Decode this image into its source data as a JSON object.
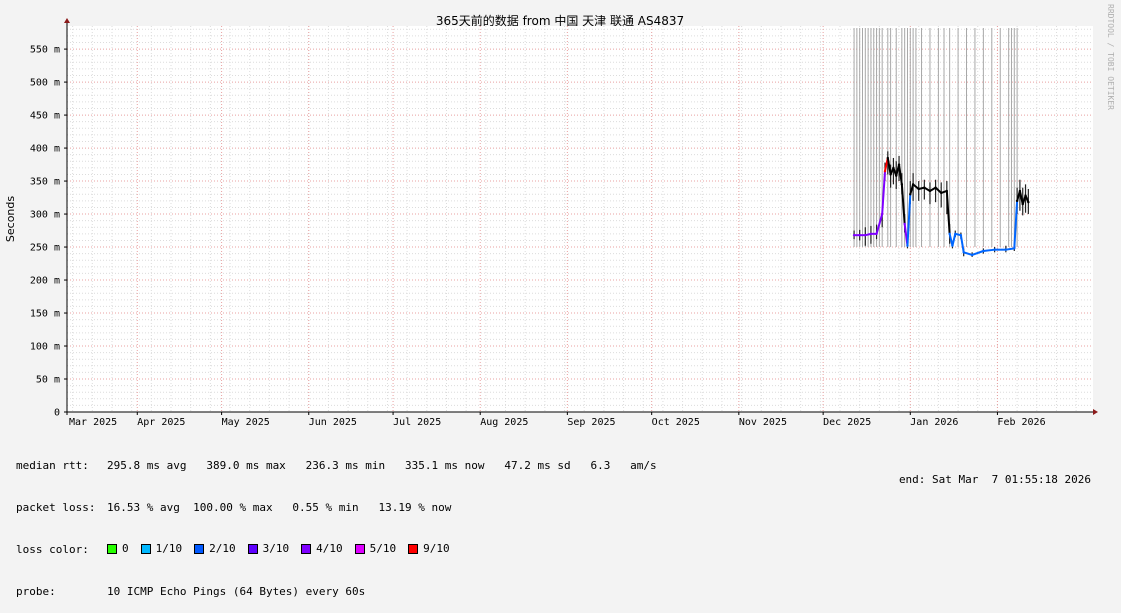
{
  "chart_data": {
    "type": "line",
    "title": "365天前的数据 from 中国 天津 联通 AS4837",
    "ylabel": "Seconds",
    "ylim": [
      0,
      0.585
    ],
    "y_ticks": [
      {
        "value": 0,
        "label": "0"
      },
      {
        "value": 0.05,
        "label": "50 m"
      },
      {
        "value": 0.1,
        "label": "100 m"
      },
      {
        "value": 0.15,
        "label": "150 m"
      },
      {
        "value": 0.2,
        "label": "200 m"
      },
      {
        "value": 0.25,
        "label": "250 m"
      },
      {
        "value": 0.3,
        "label": "300 m"
      },
      {
        "value": 0.35,
        "label": "350 m"
      },
      {
        "value": 0.4,
        "label": "400 m"
      },
      {
        "value": 0.45,
        "label": "450 m"
      },
      {
        "value": 0.5,
        "label": "500 m"
      },
      {
        "value": 0.55,
        "label": "550 m"
      }
    ],
    "xlim": [
      "2025-03-07",
      "2026-03-07"
    ],
    "x_ticks": [
      {
        "date": "2025-03-01",
        "label": "Mar 2025"
      },
      {
        "date": "2025-04-01",
        "label": "Apr 2025"
      },
      {
        "date": "2025-05-01",
        "label": "May 2025"
      },
      {
        "date": "2025-06-01",
        "label": "Jun 2025"
      },
      {
        "date": "2025-07-01",
        "label": "Jul 2025"
      },
      {
        "date": "2025-08-01",
        "label": "Aug 2025"
      },
      {
        "date": "2025-09-01",
        "label": "Sep 2025"
      },
      {
        "date": "2025-10-01",
        "label": "Oct 2025"
      },
      {
        "date": "2025-11-01",
        "label": "Nov 2025"
      },
      {
        "date": "2025-12-01",
        "label": "Dec 2025"
      },
      {
        "date": "2026-01-01",
        "label": "Jan 2026"
      },
      {
        "date": "2026-02-01",
        "label": "Feb 2026"
      }
    ],
    "grid": true,
    "series": [
      {
        "points": [
          {
            "date": "2025-12-12",
            "median": 0.268,
            "min": 0.262,
            "max": 0.275,
            "color": "#7e00ff"
          },
          {
            "date": "2025-12-14",
            "median": 0.268,
            "min": 0.26,
            "max": 0.276,
            "color": "#7e00ff"
          },
          {
            "date": "2025-12-16",
            "median": 0.268,
            "min": 0.252,
            "max": 0.28,
            "color": "#7e00ff"
          },
          {
            "date": "2025-12-18",
            "median": 0.27,
            "min": 0.255,
            "max": 0.282,
            "color": "#7e00ff"
          },
          {
            "date": "2025-12-20",
            "median": 0.27,
            "min": 0.262,
            "max": 0.284,
            "color": "#7e00ff"
          },
          {
            "date": "2025-12-22",
            "median": 0.3,
            "min": 0.28,
            "max": 0.3,
            "color": "#7e00ff"
          },
          {
            "date": "2025-12-23",
            "median": 0.365,
            "min": 0.35,
            "max": 0.378,
            "color": "#ff0000"
          },
          {
            "date": "2025-12-24",
            "median": 0.385,
            "min": 0.36,
            "max": 0.395,
            "color": "#000000"
          },
          {
            "date": "2025-12-25",
            "median": 0.36,
            "min": 0.34,
            "max": 0.375,
            "color": "#000000"
          },
          {
            "date": "2025-12-26",
            "median": 0.37,
            "min": 0.345,
            "max": 0.385,
            "color": "#000000"
          },
          {
            "date": "2025-12-27",
            "median": 0.358,
            "min": 0.338,
            "max": 0.38,
            "color": "#000000"
          },
          {
            "date": "2025-12-28",
            "median": 0.375,
            "min": 0.35,
            "max": 0.388,
            "color": "#000000"
          },
          {
            "date": "2025-12-29",
            "median": 0.345,
            "min": 0.33,
            "max": 0.362,
            "color": "#000000"
          },
          {
            "date": "2025-12-30",
            "median": 0.285,
            "min": 0.272,
            "max": 0.3,
            "color": "#7e00ff"
          },
          {
            "date": "2025-12-31",
            "median": 0.252,
            "min": 0.248,
            "max": 0.262,
            "color": "#0066ff"
          },
          {
            "date": "2026-01-01",
            "median": 0.33,
            "min": 0.315,
            "max": 0.35,
            "color": "#000000"
          },
          {
            "date": "2026-01-02",
            "median": 0.345,
            "min": 0.32,
            "max": 0.362,
            "color": "#000000"
          },
          {
            "date": "2026-01-04",
            "median": 0.338,
            "min": 0.32,
            "max": 0.35,
            "color": "#000000"
          },
          {
            "date": "2026-01-06",
            "median": 0.34,
            "min": 0.322,
            "max": 0.352,
            "color": "#000000"
          },
          {
            "date": "2026-01-08",
            "median": 0.335,
            "min": 0.315,
            "max": 0.348,
            "color": "#000000"
          },
          {
            "date": "2026-01-10",
            "median": 0.34,
            "min": 0.318,
            "max": 0.352,
            "color": "#000000"
          },
          {
            "date": "2026-01-12",
            "median": 0.332,
            "min": 0.31,
            "max": 0.348,
            "color": "#000000"
          },
          {
            "date": "2026-01-14",
            "median": 0.335,
            "min": 0.3,
            "max": 0.35,
            "color": "#000000"
          },
          {
            "date": "2026-01-15",
            "median": 0.27,
            "min": 0.255,
            "max": 0.285,
            "color": "#0066ff"
          },
          {
            "date": "2026-01-16",
            "median": 0.252,
            "min": 0.248,
            "max": 0.258,
            "color": "#0066ff"
          },
          {
            "date": "2026-01-17",
            "median": 0.27,
            "min": 0.265,
            "max": 0.275,
            "color": "#0066ff"
          },
          {
            "date": "2026-01-19",
            "median": 0.268,
            "min": 0.262,
            "max": 0.272,
            "color": "#0066ff"
          },
          {
            "date": "2026-01-20",
            "median": 0.242,
            "min": 0.236,
            "max": 0.248,
            "color": "#0066ff"
          },
          {
            "date": "2026-01-23",
            "median": 0.238,
            "min": 0.235,
            "max": 0.242,
            "color": "#0066ff"
          },
          {
            "date": "2026-01-27",
            "median": 0.244,
            "min": 0.24,
            "max": 0.248,
            "color": "#0066ff"
          },
          {
            "date": "2026-01-31",
            "median": 0.246,
            "min": 0.242,
            "max": 0.25,
            "color": "#0066ff"
          },
          {
            "date": "2026-02-04",
            "median": 0.246,
            "min": 0.242,
            "max": 0.252,
            "color": "#0066ff"
          },
          {
            "date": "2026-02-07",
            "median": 0.248,
            "min": 0.244,
            "max": 0.255,
            "color": "#0066ff"
          },
          {
            "date": "2026-02-08",
            "median": 0.32,
            "min": 0.3,
            "max": 0.34,
            "color": "#000000"
          },
          {
            "date": "2026-02-09",
            "median": 0.335,
            "min": 0.305,
            "max": 0.352,
            "color": "#000000"
          },
          {
            "date": "2026-02-10",
            "median": 0.315,
            "min": 0.298,
            "max": 0.34,
            "color": "#000000"
          },
          {
            "date": "2026-02-11",
            "median": 0.328,
            "min": 0.302,
            "max": 0.345,
            "color": "#000000"
          },
          {
            "date": "2026-02-12",
            "median": 0.318,
            "min": 0.3,
            "max": 0.338,
            "color": "#000000"
          }
        ],
        "loss_spikes": [
          "2025-12-12",
          "2025-12-13",
          "2025-12-14",
          "2025-12-15",
          "2025-12-16",
          "2025-12-17",
          "2025-12-18",
          "2025-12-19",
          "2025-12-20",
          "2025-12-21",
          "2025-12-22",
          "2025-12-24",
          "2025-12-25",
          "2025-12-27",
          "2025-12-29",
          "2025-12-30",
          "2025-12-31",
          "2026-01-01",
          "2026-01-02",
          "2026-01-03",
          "2026-01-05",
          "2026-01-08",
          "2026-01-11",
          "2026-01-13",
          "2026-01-15",
          "2026-01-18",
          "2026-01-21",
          "2026-01-24",
          "2026-01-27",
          "2026-01-30",
          "2026-02-02",
          "2026-02-05",
          "2026-02-06",
          "2026-02-07",
          "2026-02-08"
        ]
      }
    ]
  },
  "watermark": "RRDTOOL / TOBI OETIKER",
  "legend": {
    "median_rtt": {
      "label": "median rtt:",
      "value": "295.8 ms avg   389.0 ms max   236.3 ms min   335.1 ms now   47.2 ms sd   6.3   am/s"
    },
    "packet_loss": {
      "label": "packet loss:",
      "value": "16.53 % avg  100.00 % max   0.55 % min   13.19 % now"
    },
    "loss_color": {
      "label": "loss color:",
      "items": [
        {
          "label": "0",
          "color": "#26ff00"
        },
        {
          "label": "1/10",
          "color": "#00b8ff"
        },
        {
          "label": "2/10",
          "color": "#0059ff"
        },
        {
          "label": "3/10",
          "color": "#5e00ff"
        },
        {
          "label": "4/10",
          "color": "#7e00ff"
        },
        {
          "label": "5/10",
          "color": "#dd00ff"
        },
        {
          "label": "9/10",
          "color": "#ff0000"
        }
      ]
    },
    "probe": {
      "label": "probe:",
      "value": "10 ICMP Echo Pings (64 Bytes) every 60s"
    },
    "end": "end: Sat Mar  7 01:55:18 2026"
  },
  "colors": {
    "background": "#f3f3f3",
    "plot_background": "#ffffff",
    "minor_grid": "#dcdcdc",
    "major_grid": "#e8a0a0",
    "smoke": "#a8a8a8",
    "axis": "#000000",
    "arrow": "#8b1a1a"
  }
}
